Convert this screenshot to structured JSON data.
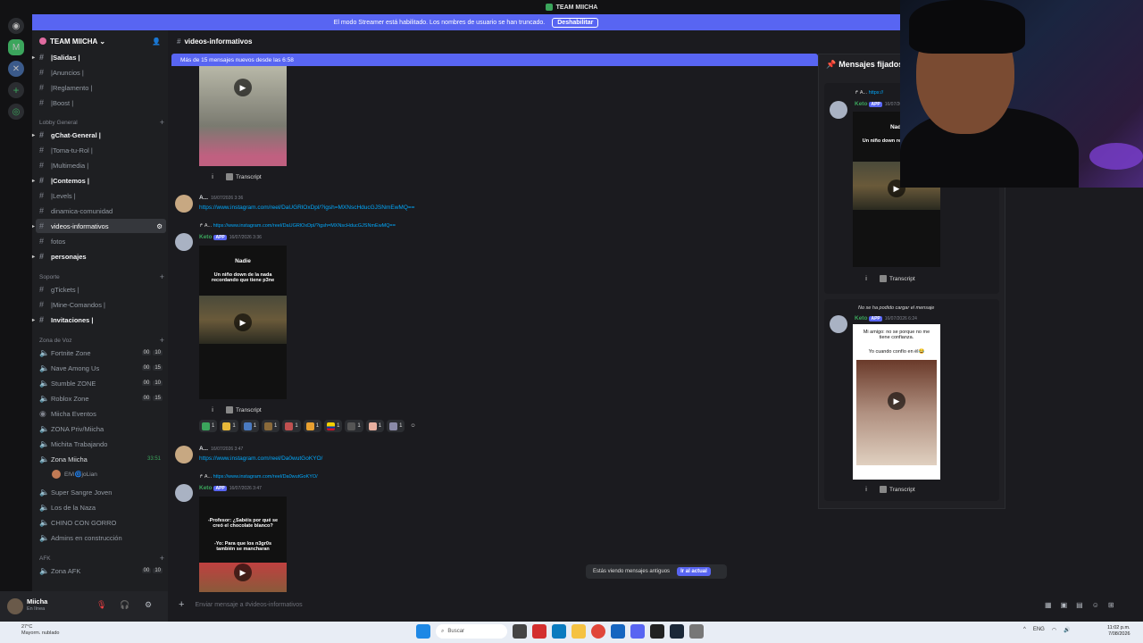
{
  "window": {
    "title": "TEAM MIICHA"
  },
  "banner": {
    "text": "El modo Streamer está habilitado. Los nombres de usuario se han truncado.",
    "button": "Deshabilitar"
  },
  "server": {
    "name": "TEAM MIICHA"
  },
  "channels": [
    {
      "label": "|Salidas |",
      "bold": true
    },
    {
      "label": "|Anuncios |"
    },
    {
      "label": "|Reglamento |"
    },
    {
      "label": "|Boost |"
    },
    {
      "label": "Lobby General",
      "category": true
    },
    {
      "label": "gChat-General |",
      "bold": true
    },
    {
      "label": "|Toma-tu-Rol |"
    },
    {
      "label": "|Multimedia |"
    },
    {
      "label": "|Contemos |",
      "bold": true
    },
    {
      "label": "|Levels |"
    },
    {
      "label": "dinamica-comunidad"
    },
    {
      "label": "videos-informativos",
      "active": true
    },
    {
      "label": "fotos"
    },
    {
      "label": "personajes",
      "bold": true
    },
    {
      "label": "Soporte",
      "category": true
    },
    {
      "label": "gTickets |"
    },
    {
      "label": "|Mine-Comandos |"
    },
    {
      "label": "Invitaciones |",
      "bold": true
    },
    {
      "label": "Zona de Voz",
      "category": true
    }
  ],
  "voice": [
    {
      "label": "Fortnite Zone",
      "a": "00",
      "b": "10"
    },
    {
      "label": "Nave Among Us",
      "a": "00",
      "b": "15"
    },
    {
      "label": "Stumble ZONE",
      "a": "00",
      "b": "10"
    },
    {
      "label": "Roblox Zone",
      "a": "00",
      "b": "15"
    },
    {
      "label": "Miicha Eventos",
      "a": "",
      "b": ""
    },
    {
      "label": "ZONA Priv/Miicha",
      "a": "",
      "b": ""
    },
    {
      "label": "Michita Trabajando",
      "a": "",
      "b": ""
    },
    {
      "label": "Zona Miicha",
      "a": "33:51",
      "b": ""
    },
    {
      "label": "ElVi🌀joLian",
      "a": "",
      "b": ""
    },
    {
      "label": "Super Sangre Joven",
      "a": "",
      "b": ""
    },
    {
      "label": "Los de la Naza",
      "a": "",
      "b": ""
    },
    {
      "label": "CHINO CON GORRO",
      "a": "",
      "b": ""
    },
    {
      "label": "Admins en construcción",
      "a": "",
      "b": ""
    }
  ],
  "afk_category": "AFK",
  "afk": {
    "label": "Zona AFK",
    "a": "00",
    "b": "10"
  },
  "user": {
    "name": "Miicha",
    "status": "En línea"
  },
  "channel_header": "videos-informativos",
  "new_messages": "Más de 15 mensajes nuevos desde las 6:58",
  "messages": [
    {
      "author": "A...",
      "time": "16/07/2026 3:36",
      "link": "https://www.instagram.com/reel/DaUGRlOxDpl/?igsh=MXNscHducGJSNmEwMQ=="
    },
    {
      "author": "A...",
      "time": "16/07/2026 3:47",
      "link": "https://www.instagram.com/reel/Da0wutGoKYO/"
    }
  ],
  "bot": {
    "name": "Keto",
    "badge": "APP"
  },
  "bot_times": [
    "16/07/2026 3:36",
    "16/07/2026 3:47"
  ],
  "video1": {
    "title": "Nadie",
    "sub": "Un niño down de la nada recordando que tiene p3ne"
  },
  "video2": {
    "line1": "-Profesor: ¿Sabéis por qué se creó el chocolate blanco?",
    "line2": "-Yo: Para que los n3gr0s también se mancharan"
  },
  "transcript": "Transcript",
  "info": "i",
  "reactions": [
    "1",
    "1",
    "1",
    "1",
    "1",
    "1",
    "1",
    "1",
    "1",
    "1"
  ],
  "old_messages": {
    "text": "Estás viendo mensajes antiguos",
    "button": "Ir al actual"
  },
  "composer": {
    "placeholder": "Enviar mensaje a #videos-informativos"
  },
  "pinned": {
    "title": "Mensajes fijados",
    "card1_link": "https://",
    "card1_time": "16/07/2026",
    "card2_error": "No se ha podido cargar el mensaje",
    "card2_time": "16/07/2026 6:24",
    "card2_text1": "Mi amigo: no se porque no me tiene confianza.",
    "card2_text2": "Yo cuando confío en él😂",
    "card1_video_title": "Nadi",
    "card1_video_sub": "Un niño down recordando qu"
  },
  "taskbar": {
    "temp": "27°C",
    "weather": "Mayorm. nublado",
    "search": "Buscar",
    "lang": "ENG",
    "time": "11:02 p.m.",
    "date": "7/08/2026"
  },
  "colors": {
    "accent": "#5865f2",
    "bot": "#3ba55c",
    "link": "#00a8fc"
  }
}
